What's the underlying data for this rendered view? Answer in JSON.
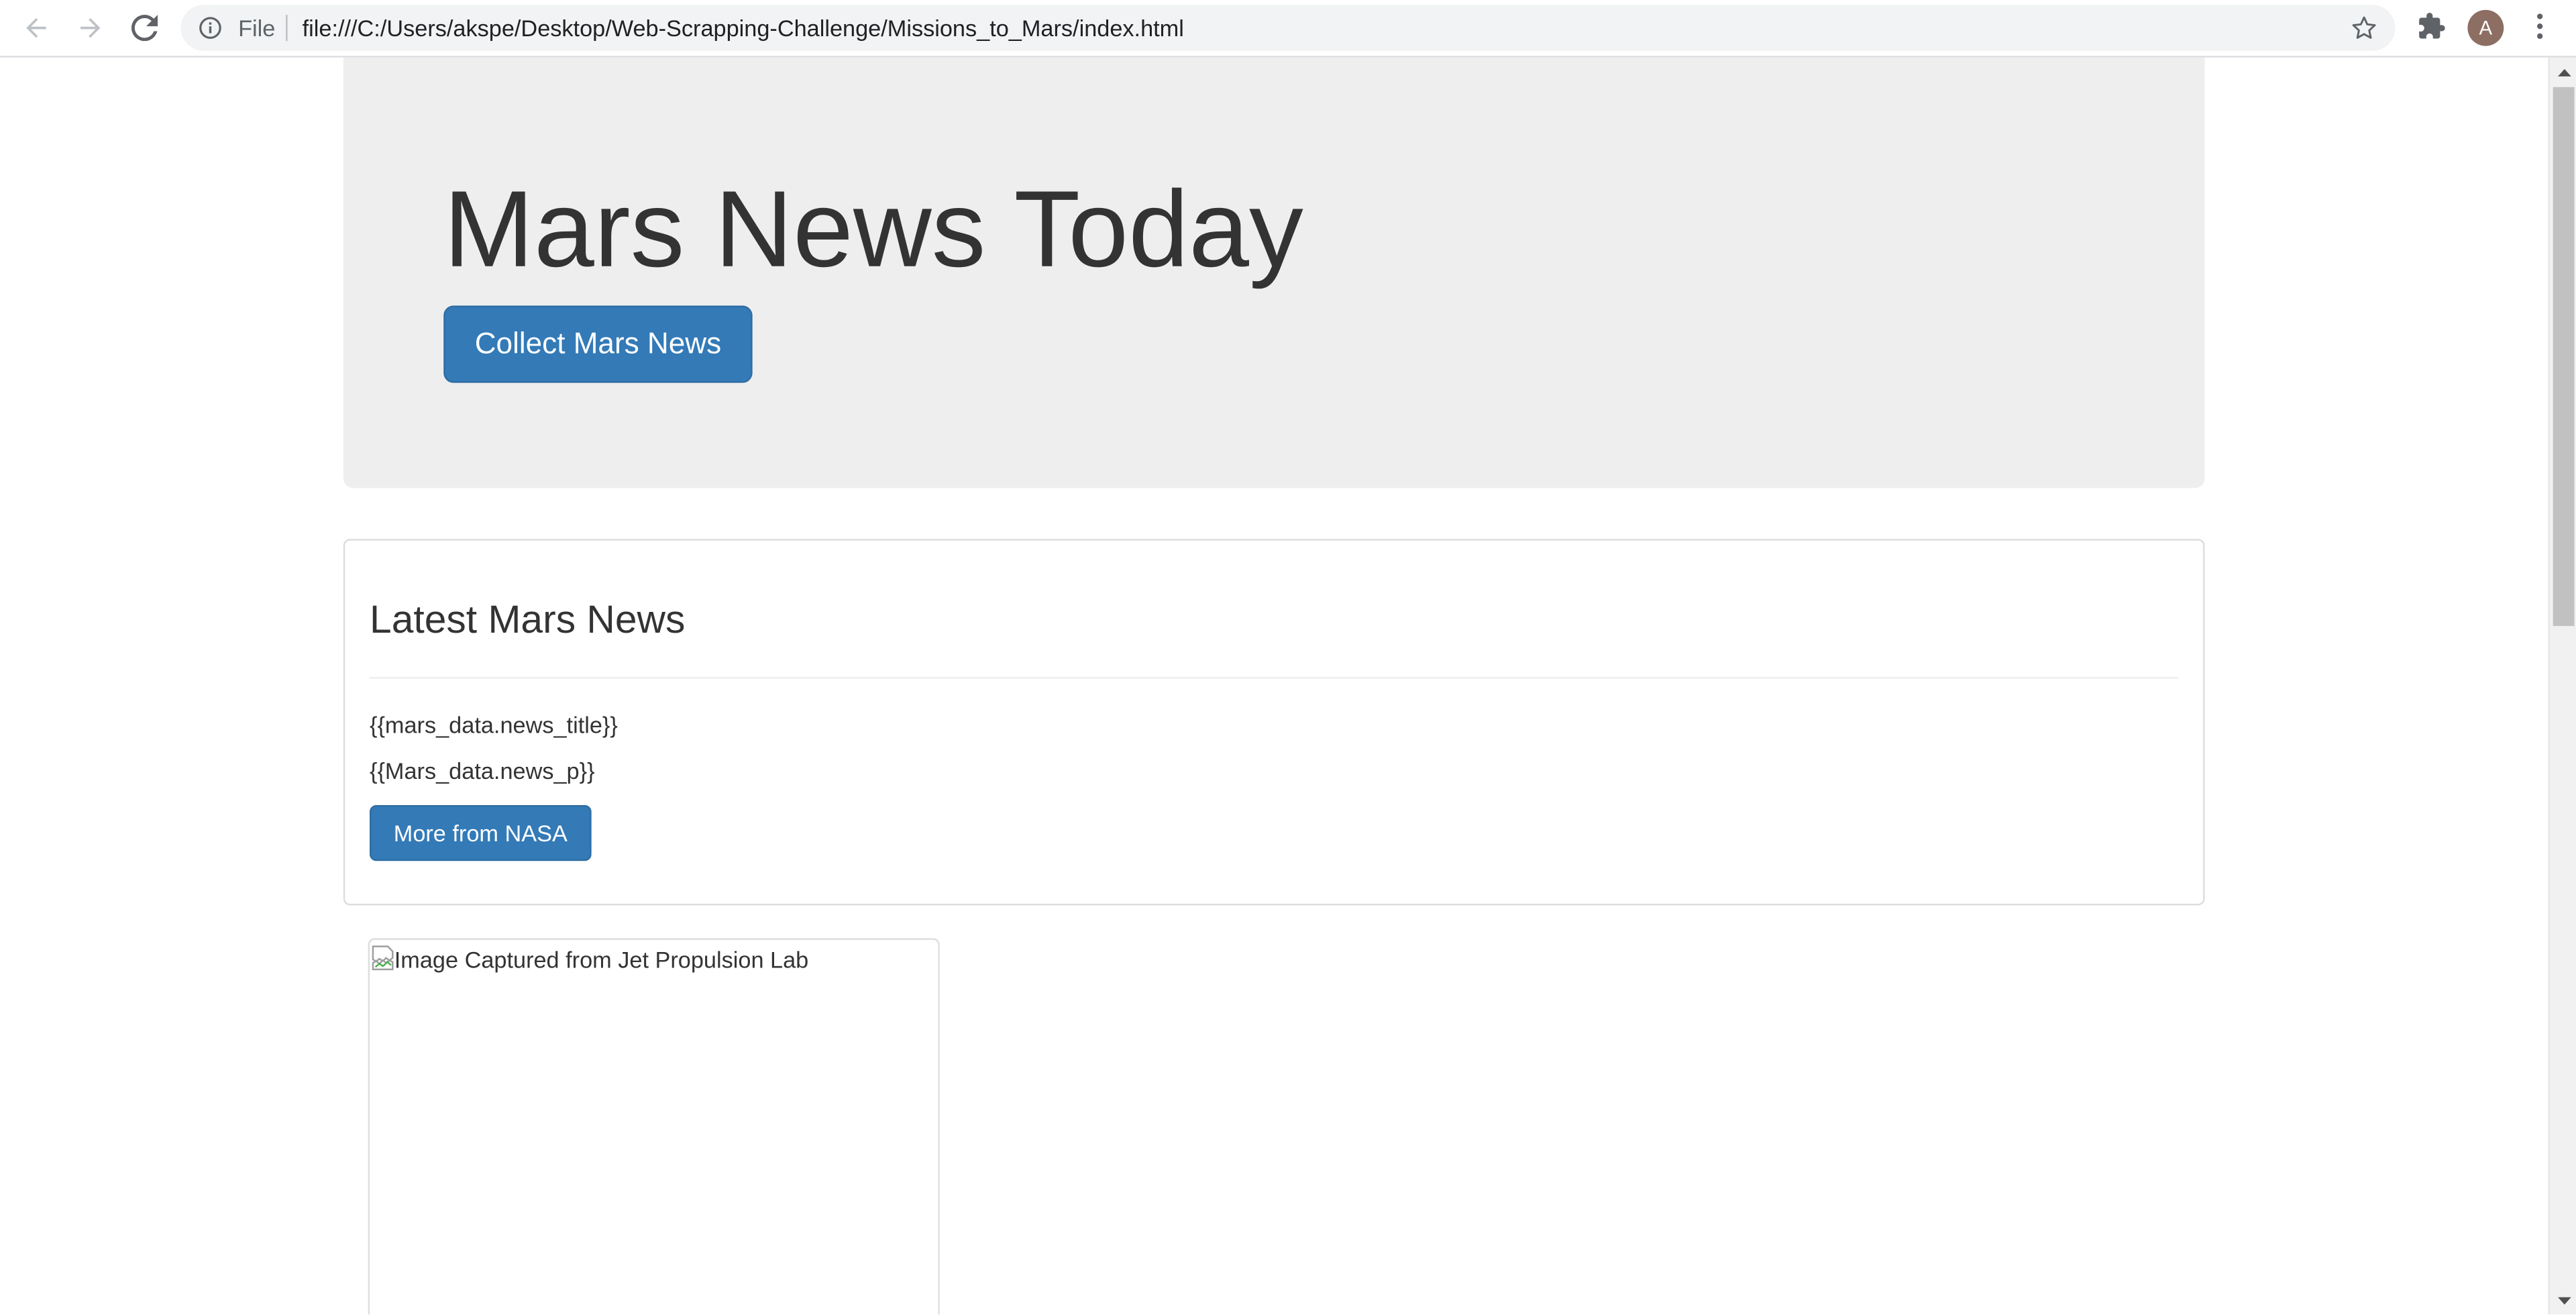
{
  "browser": {
    "url_scheme_label": "File",
    "url": "file:///C:/Users/akspe/Desktop/Web-Scrapping-Challenge/Missions_to_Mars/index.html",
    "profile_initial": "A"
  },
  "page": {
    "jumbotron": {
      "title": "Mars News Today",
      "button_label": "Collect Mars News"
    },
    "news_panel": {
      "heading": "Latest Mars News",
      "news_title": "{{mars_data.news_title}}",
      "news_paragraph": "{{Mars_data.news_p}}",
      "button_label": "More from NASA"
    },
    "featured_image": {
      "alt_text": "Image Captured from Jet Propulsion Lab"
    }
  },
  "scrollbar": {
    "position_fraction": 0.0,
    "visible_fraction": 0.45
  },
  "colors": {
    "primary_button": "#337ab7",
    "jumbotron_bg": "#eeeeee",
    "avatar_bg": "#8d6e63"
  }
}
